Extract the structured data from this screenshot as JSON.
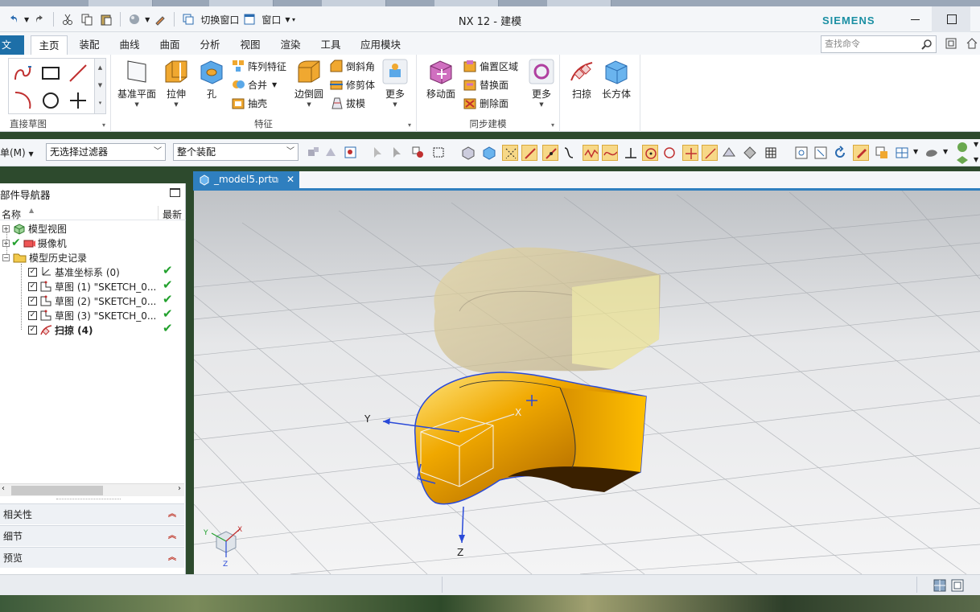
{
  "window": {
    "title": "NX 12 - 建模",
    "brand": "SIEMENS"
  },
  "quick_access": {
    "switch_window": "切换窗口",
    "window_menu": "窗口"
  },
  "tabs": {
    "file_stub": "文",
    "items": [
      "主页",
      "装配",
      "曲线",
      "曲面",
      "分析",
      "视图",
      "渲染",
      "工具",
      "应用模块"
    ],
    "active": "主页"
  },
  "search": {
    "placeholder": "查找命令"
  },
  "ribbon": {
    "direct_sketch": {
      "label": "直接草图"
    },
    "feature": {
      "label": "特征",
      "datum_plane": "基准平面",
      "extrude": "拉伸",
      "hole": "孔",
      "pattern_feature": "阵列特征",
      "unite": "合并",
      "shell": "抽壳",
      "edge_blend": "边倒圆",
      "chamfer": "倒斜角",
      "trim_body": "修剪体",
      "draft": "拔模",
      "more": "更多"
    },
    "sync_modeling": {
      "label": "同步建模",
      "move_face": "移动面",
      "offset_region": "偏置区域",
      "replace_face": "替换面",
      "delete_face": "删除面",
      "more": "更多"
    },
    "extra": {
      "sweep": "扫掠",
      "block": "长方体"
    }
  },
  "toolbar": {
    "menu": "单(M)",
    "filter": "无选择过滤器",
    "scope": "整个装配"
  },
  "navigator": {
    "title": "部件导航器",
    "col_name": "名称",
    "col_latest": "最新",
    "nodes": [
      {
        "label": "模型视图"
      },
      {
        "label": "摄像机"
      },
      {
        "label": "模型历史记录"
      },
      {
        "label": "基准坐标系 (0)"
      },
      {
        "label": "草图 (1) \"SKETCH_0..."
      },
      {
        "label": "草图 (2) \"SKETCH_0..."
      },
      {
        "label": "草图 (3) \"SKETCH_0..."
      },
      {
        "label": "扫掠 (4)"
      }
    ],
    "panels": [
      "相关性",
      "细节",
      "预览"
    ]
  },
  "document": {
    "tab": "_model5.prt"
  },
  "viewport": {
    "axis_labels": {
      "x": "X",
      "y": "Y",
      "z": "Z"
    },
    "solid_color": "#f0a800",
    "preview_color": "#e8d070"
  },
  "colors": {
    "accent": "#2f7fbf",
    "brand": "#1a8fa3",
    "ok": "#23a12e"
  }
}
